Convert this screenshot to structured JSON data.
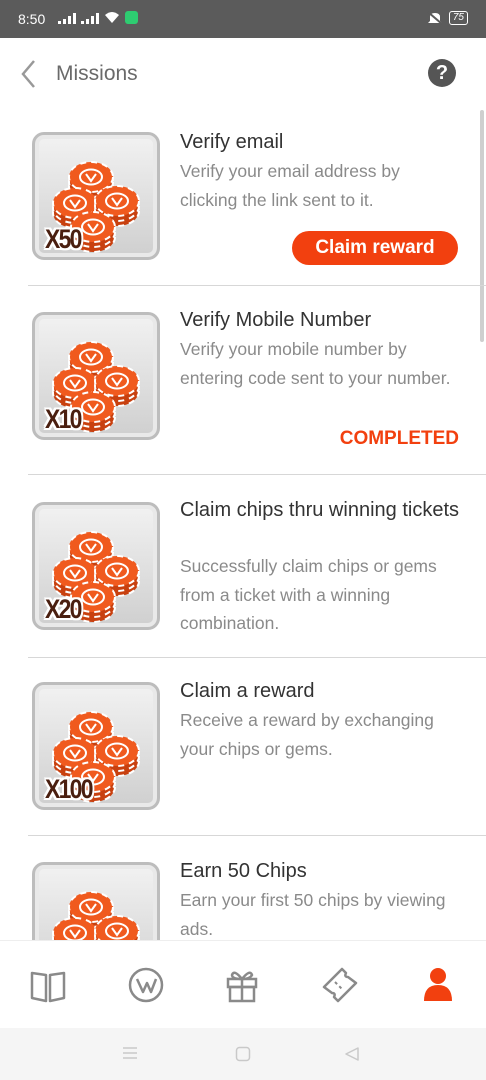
{
  "status_bar": {
    "time": "8:50",
    "battery": "75"
  },
  "header": {
    "title": "Missions"
  },
  "missions": [
    {
      "title": "Verify email",
      "description": "Verify your email address by clicking the link sent to it.",
      "multiplier": "X50",
      "action": "Claim reward"
    },
    {
      "title": "Verify Mobile Number",
      "description": "Verify your mobile number by entering code sent to your number.",
      "multiplier": "X10",
      "status": "COMPLETED"
    },
    {
      "title": "Claim chips thru winning tickets",
      "description": "Successfully claim chips or gems from a ticket with a winning combination.",
      "multiplier": "X20"
    },
    {
      "title": "Claim a reward",
      "description": "Receive a reward by exchanging your chips or gems.",
      "multiplier": "X100"
    },
    {
      "title": "Earn 50 Chips",
      "description": "Earn your first 50 chips by viewing ads.",
      "multiplier": ""
    }
  ],
  "bottom_nav": {
    "items": [
      {
        "icon": "book-icon"
      },
      {
        "icon": "logo-icon"
      },
      {
        "icon": "gift-icon"
      },
      {
        "icon": "ticket-icon"
      },
      {
        "icon": "profile-icon",
        "active": true
      }
    ]
  },
  "colors": {
    "accent": "#f2400f",
    "status_bar": "#5b5b5b"
  }
}
